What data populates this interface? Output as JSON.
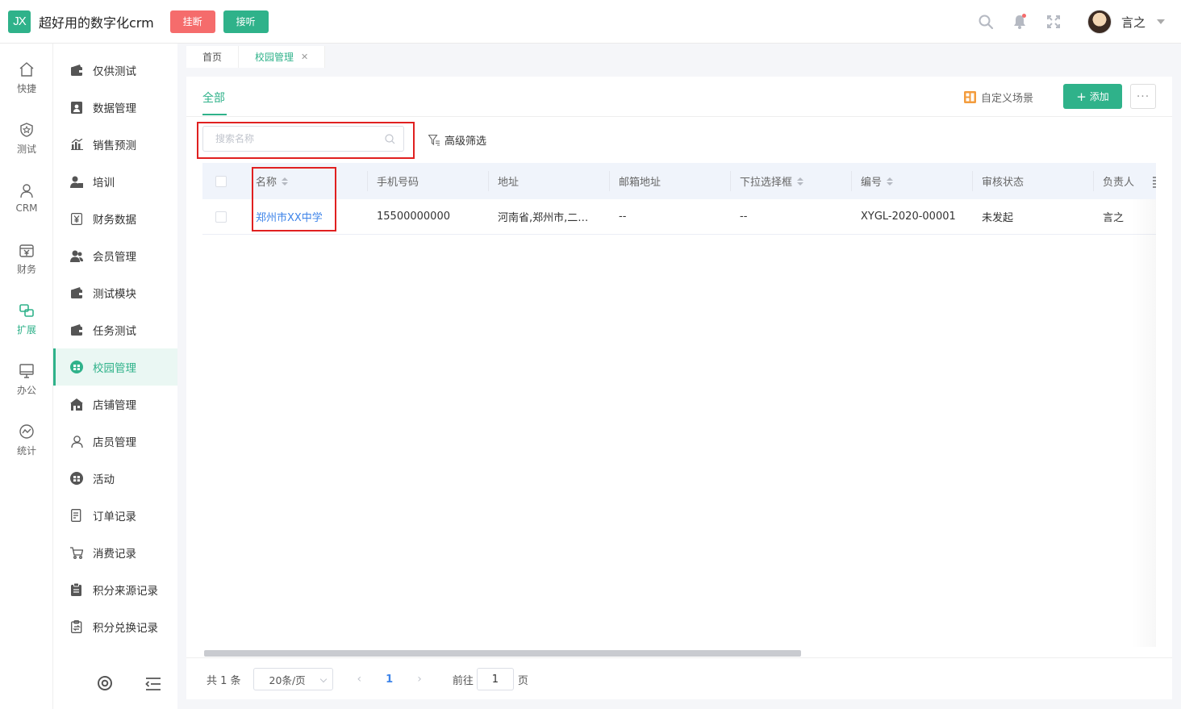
{
  "header": {
    "logo_text": "JX",
    "app_title": "超好用的数字化crm",
    "hang_up_label": "挂断",
    "answer_label": "接听",
    "user_name": "言之",
    "colors": {
      "brand": "#2fb28a",
      "danger": "#f56c6c"
    }
  },
  "leftnav": {
    "items": [
      {
        "label": "快捷",
        "icon": "home-icon",
        "active": false
      },
      {
        "label": "测试",
        "icon": "shield-star-icon",
        "active": false
      },
      {
        "label": "CRM",
        "icon": "person-icon",
        "active": false
      },
      {
        "label": "财务",
        "icon": "yen-box-icon",
        "active": false
      },
      {
        "label": "扩展",
        "icon": "extend-icon",
        "active": true
      },
      {
        "label": "办公",
        "icon": "monitor-icon",
        "active": false
      },
      {
        "label": "统计",
        "icon": "chart-circle-icon",
        "active": false
      }
    ]
  },
  "submenu": {
    "items": [
      {
        "label": "仅供测试",
        "icon": "wallet-icon"
      },
      {
        "label": "数据管理",
        "icon": "contact-card-icon"
      },
      {
        "label": "销售预测",
        "icon": "bar-chart-icon"
      },
      {
        "label": "培训",
        "icon": "user-train-icon"
      },
      {
        "label": "财务数据",
        "icon": "yen-icon"
      },
      {
        "label": "会员管理",
        "icon": "members-icon"
      },
      {
        "label": "测试模块",
        "icon": "wallet-icon"
      },
      {
        "label": "任务测试",
        "icon": "wallet-icon"
      },
      {
        "label": "校园管理",
        "icon": "campus-icon"
      },
      {
        "label": "店铺管理",
        "icon": "shop-icon"
      },
      {
        "label": "店员管理",
        "icon": "staff-icon"
      },
      {
        "label": "活动",
        "icon": "activity-icon"
      },
      {
        "label": "订单记录",
        "icon": "order-icon"
      },
      {
        "label": "消费记录",
        "icon": "cart-icon"
      },
      {
        "label": "积分来源记录",
        "icon": "clipboard-icon"
      },
      {
        "label": "积分兑换记录",
        "icon": "exchange-icon"
      }
    ],
    "active_index": 8
  },
  "tabs": [
    {
      "label": "首页",
      "active": false,
      "closable": false
    },
    {
      "label": "校园管理",
      "active": true,
      "closable": true
    }
  ],
  "toolbar": {
    "scene_tab": "全部",
    "custom_scene_label": "自定义场景",
    "add_label": "添加",
    "more_label": "···",
    "search_placeholder": "搜索名称",
    "advanced_filter_label": "高级筛选"
  },
  "table": {
    "columns": [
      {
        "label": "名称",
        "sortable": true
      },
      {
        "label": "手机号码",
        "sortable": false
      },
      {
        "label": "地址",
        "sortable": false
      },
      {
        "label": "邮箱地址",
        "sortable": false
      },
      {
        "label": "下拉选择框",
        "sortable": true
      },
      {
        "label": "编号",
        "sortable": true
      },
      {
        "label": "审核状态",
        "sortable": false
      },
      {
        "label": "负责人",
        "sortable": false
      }
    ],
    "rows": [
      [
        "郑州市XX中学",
        "15500000000",
        "河南省,郑州市,二…",
        "--",
        "--",
        "XYGL-2020-00001",
        "未发起",
        "言之"
      ]
    ]
  },
  "pagination": {
    "total_text": "共 1 条",
    "page_size": "20条/页",
    "current_page": "1",
    "goto_label": "前往",
    "goto_value": "1",
    "page_unit": "页"
  }
}
